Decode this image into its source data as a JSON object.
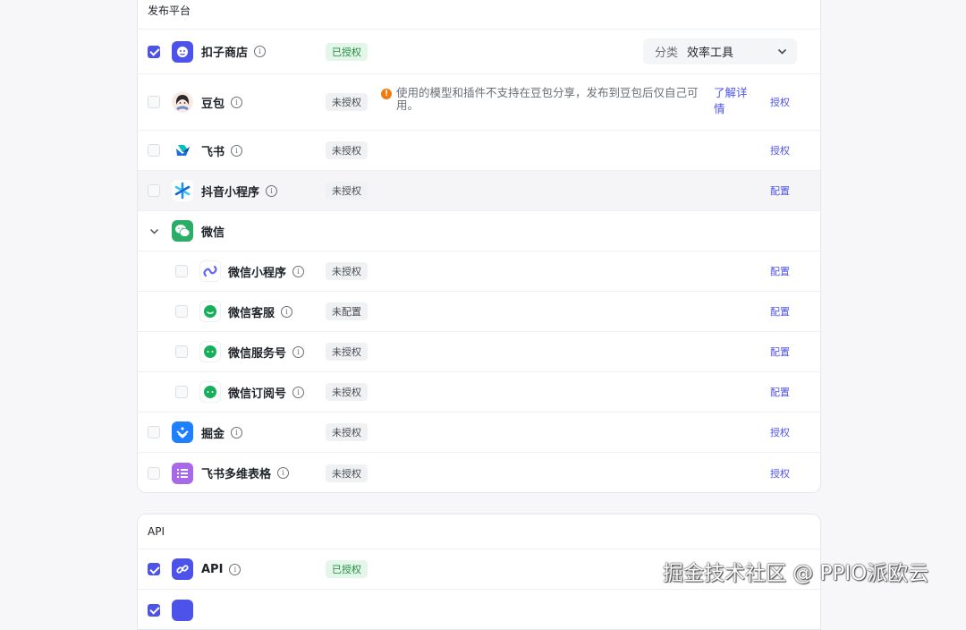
{
  "publish_section": {
    "title": "发布平台",
    "rows": [
      {
        "name": "扣子商店",
        "status": "已授权",
        "checked": true
      },
      {
        "name": "豆包",
        "status": "未授权",
        "warning": "使用的模型和插件不支持在豆包分享，发布到豆包后仅自己可用。",
        "learn_more": "了解详情",
        "action": "授权"
      },
      {
        "name": "飞书",
        "status": "未授权",
        "action": "授权"
      },
      {
        "name": "抖音小程序",
        "status": "未授权",
        "action": "配置"
      },
      {
        "name": "微信"
      },
      {
        "name": "微信小程序",
        "status": "未授权",
        "action": "配置"
      },
      {
        "name": "微信客服",
        "status": "未配置",
        "action": "配置"
      },
      {
        "name": "微信服务号",
        "status": "未授权",
        "action": "配置"
      },
      {
        "name": "微信订阅号",
        "status": "未授权",
        "action": "配置"
      },
      {
        "name": "掘金",
        "status": "未授权",
        "action": "授权"
      },
      {
        "name": "飞书多维表格",
        "status": "未授权",
        "action": "授权"
      }
    ],
    "category_select": {
      "label": "分类",
      "value": "效率工具"
    }
  },
  "api_section": {
    "title": "API",
    "rows": [
      {
        "name": "API",
        "status": "已授权",
        "checked": true
      }
    ]
  },
  "info_glyph": "i",
  "warn_glyph": "!",
  "watermark": "掘金技术社区 @ PPIO派欧云",
  "colors": {
    "accent": "#4d53e8",
    "authorized_bg": "#e4f6e9",
    "authorized_text": "#1f8c3e",
    "warn": "#f07b10"
  }
}
